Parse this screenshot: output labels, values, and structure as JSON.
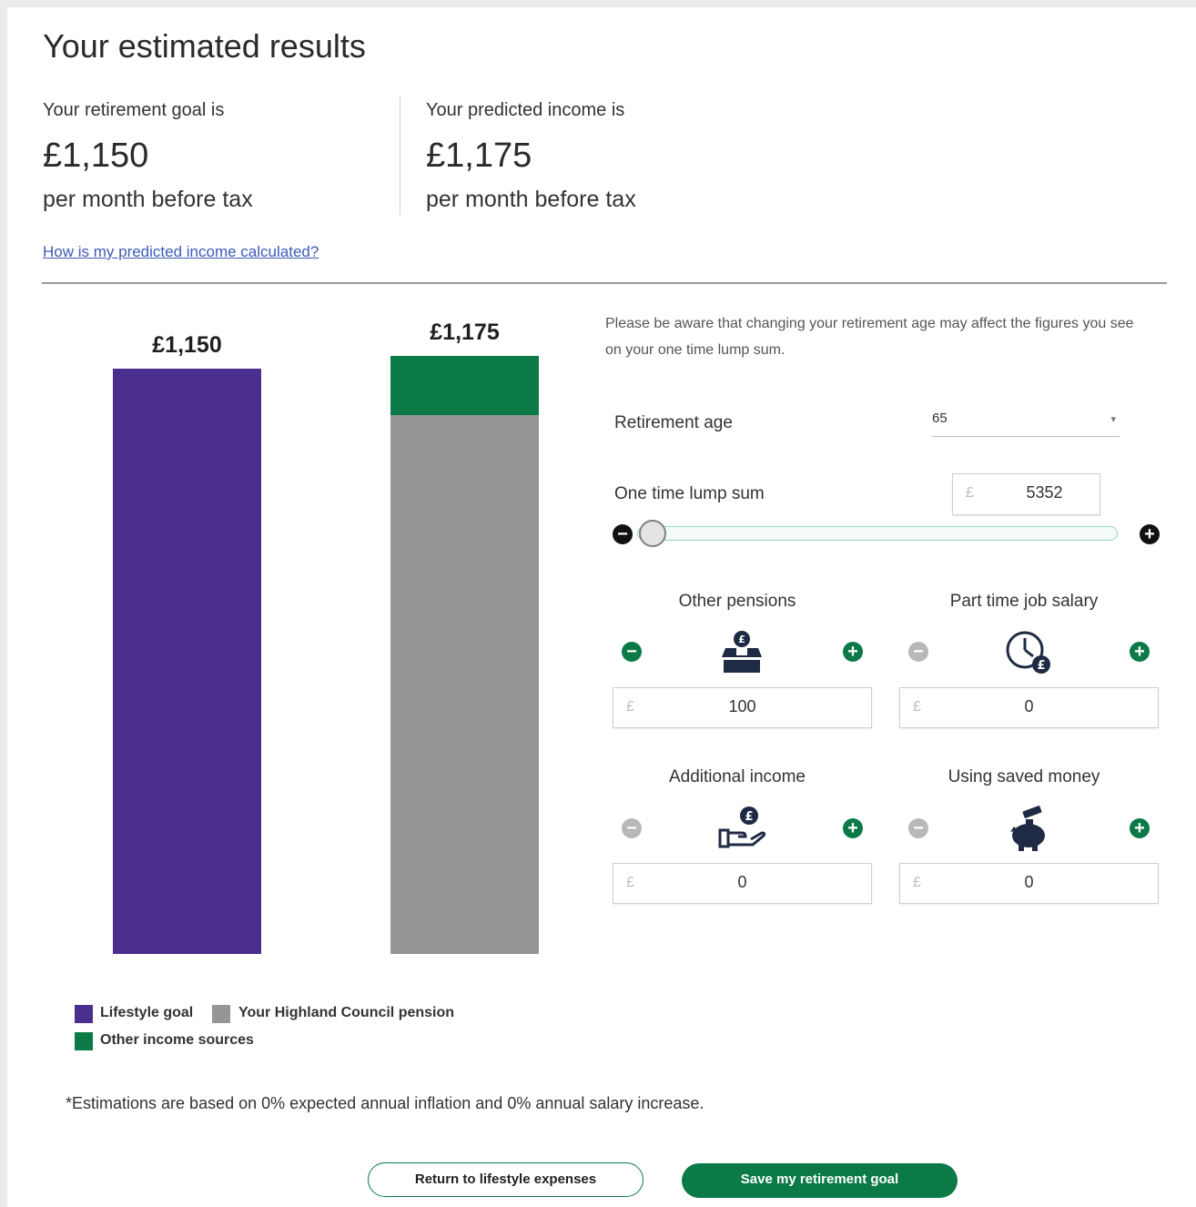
{
  "header": {
    "title": "Your estimated results",
    "goal_label": "Your retirement goal is",
    "goal_value": "£1,150",
    "goal_period": "per month before tax",
    "predicted_label": "Your predicted income is",
    "predicted_value": "£1,175",
    "predicted_period": "per month before tax",
    "calc_link": "How is my predicted income calculated?"
  },
  "chart_data": {
    "type": "bar",
    "categories": [
      "Lifestyle goal",
      "Predicted income"
    ],
    "data_labels": [
      "£1,150",
      "£1,175"
    ],
    "series": [
      {
        "name": "Lifestyle goal",
        "values": [
          1150,
          0
        ],
        "color": "#4b2f8f"
      },
      {
        "name": "Your Highland Council pension",
        "values": [
          0,
          1059
        ],
        "color": "#959595"
      },
      {
        "name": "Other income sources",
        "values": [
          0,
          116
        ],
        "color": "#0b7a47"
      }
    ],
    "legend": [
      "Lifestyle goal",
      "Your Highland Council pension",
      "Other income sources"
    ],
    "legend_position": "bottom-left",
    "ylim": [
      0,
      1175
    ]
  },
  "controls": {
    "note": "Please be aware that changing your retirement age may affect the figures you see on your one time lump sum.",
    "retirement_age_label": "Retirement age",
    "retirement_age_value": "65",
    "lump_sum_label": "One time lump sum",
    "currency_symbol": "£",
    "lump_sum_value": "5352",
    "minus_symbol": "−",
    "plus_symbol": "+",
    "cards": [
      {
        "label": "Other pensions",
        "value": "100",
        "icon": "pension-box-icon"
      },
      {
        "label": "Part time job salary",
        "value": "0",
        "icon": "clock-pound-icon"
      },
      {
        "label": "Additional income",
        "value": "0",
        "icon": "hand-pound-icon"
      },
      {
        "label": "Using saved money",
        "value": "0",
        "icon": "piggy-bank-icon"
      }
    ]
  },
  "footnote": "*Estimations are based on 0% expected annual inflation and 0% annual salary increase.",
  "buttons": {
    "return_label": "Return to lifestyle expenses",
    "save_label": "Save my retirement goal"
  },
  "colors": {
    "accent": "#0b7a47",
    "goal": "#4b2f8f",
    "pension": "#959595"
  }
}
